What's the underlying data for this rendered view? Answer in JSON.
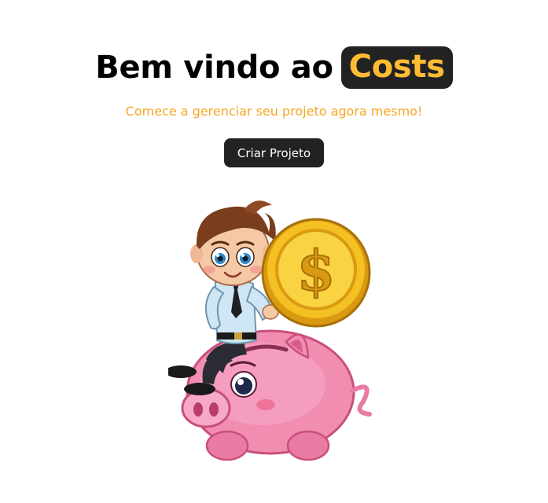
{
  "hero": {
    "title_prefix": "Bem vindo ao",
    "brand": "Costs",
    "subtitle": "Comece a gerenciar seu projeto agora mesmo!",
    "cta_label": "Criar Projeto"
  },
  "illustration": {
    "icon": "savings-piggy-bank-icon"
  },
  "colors": {
    "brand_text": "#ffbb33",
    "brand_bg": "#222222",
    "subtitle": "#f5a623",
    "button_bg": "#222222",
    "button_text": "#ffffff"
  }
}
